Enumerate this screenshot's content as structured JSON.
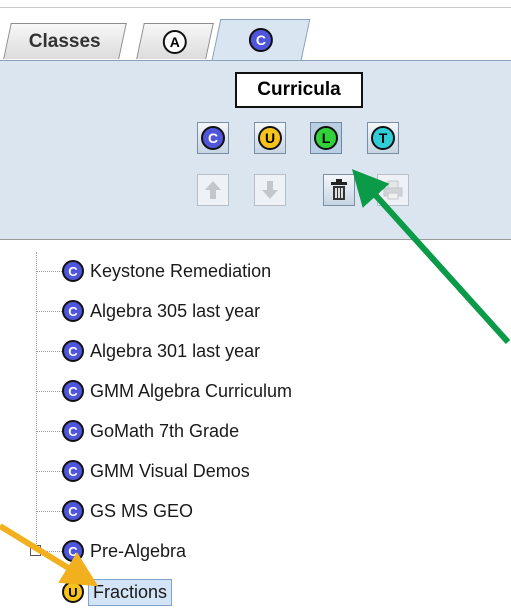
{
  "tabs": {
    "classes_label": "Classes",
    "tab_a_letter": "A",
    "tab_c_letter": "C"
  },
  "tooltip": "Curricula",
  "type_buttons": [
    {
      "letter": "C",
      "color": "#4f56dc"
    },
    {
      "letter": "U",
      "color": "#f6c21c"
    },
    {
      "letter": "L",
      "color": "#31d13a"
    },
    {
      "letter": "T",
      "color": "#2fcdd7"
    }
  ],
  "action_icons": [
    "up-arrow-icon",
    "down-arrow-icon",
    "trash-icon",
    "print-icon"
  ],
  "tree": {
    "items": [
      {
        "letter": "C",
        "label": "Keystone Remediation"
      },
      {
        "letter": "C",
        "label": "Algebra 305 last year"
      },
      {
        "letter": "C",
        "label": "Algebra 301 last year"
      },
      {
        "letter": "C",
        "label": "GMM Algebra Curriculum"
      },
      {
        "letter": "C",
        "label": "GoMath 7th Grade"
      },
      {
        "letter": "C",
        "label": "GMM Visual Demos"
      },
      {
        "letter": "C",
        "label": "GS MS GEO"
      },
      {
        "letter": "C",
        "label": "Pre-Algebra"
      }
    ],
    "selected_child": {
      "letter": "U",
      "label": "Fractions"
    },
    "toggle_symbol": "-"
  },
  "annotation_colors": {
    "green_arrow": "#0a9a48",
    "yellow_arrow": "#f2b01e"
  }
}
